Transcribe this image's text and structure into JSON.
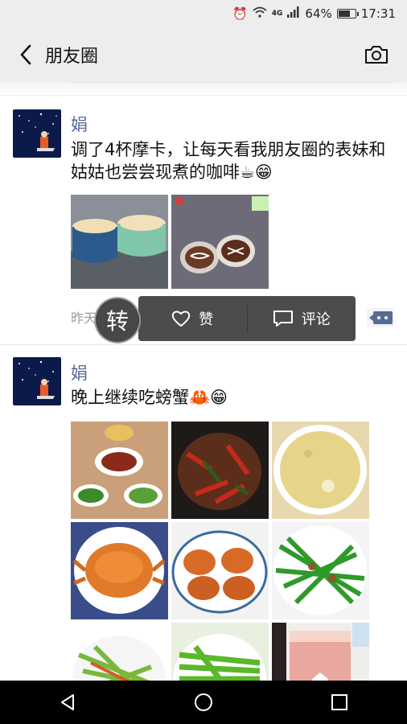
{
  "status_bar": {
    "network_label": "4G",
    "battery_percent": "64%",
    "battery_level": 0.64,
    "time": "17:31"
  },
  "nav": {
    "title": "朋友圈",
    "back_icon": "chevron-left-icon",
    "camera_icon": "camera-icon"
  },
  "posts": [
    {
      "name": "娟",
      "text": "调了4杯摩卡，让每天看我朋友圈的表妹和姑姑也尝尝现煮的咖啡☕😁",
      "photos": [
        "coffee-cups",
        "mocha-cups"
      ],
      "time_label": "昨天"
    },
    {
      "name": "娟",
      "text": "晚上继续吃螃蟹🦀😁",
      "photos": [
        "dishes-table",
        "spicy-stirfry",
        "soup-bowl",
        "crab-plate",
        "crabs-four",
        "chives-stirfry",
        "celery-stirfry",
        "green-beans",
        "pink-drink"
      ]
    }
  ],
  "action_popup": {
    "like_label": "赞",
    "comment_label": "评论",
    "like_icon": "heart-icon",
    "comment_icon": "comment-icon"
  },
  "watermark_char": "转",
  "android_nav": {
    "back_icon": "triangle-back-icon",
    "home_icon": "circle-home-icon",
    "recents_icon": "square-recents-icon"
  }
}
